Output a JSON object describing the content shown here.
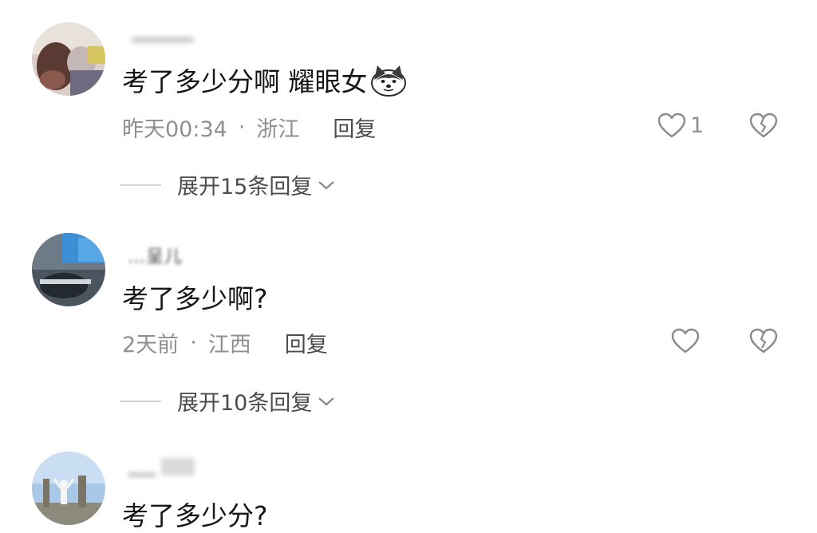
{
  "comments": [
    {
      "username": "",
      "text": "考了多少分啊 耀眼女",
      "emoji_icon": "husky-dog-icon",
      "time": "昨天00:34",
      "separator": "·",
      "location": "浙江",
      "reply_label": "回复",
      "likes": "1",
      "expand_label": "展开15条回复"
    },
    {
      "username": "…呈儿",
      "text": "考了多少啊?",
      "time": "2天前",
      "separator": "·",
      "location": "江西",
      "reply_label": "回复",
      "likes": "",
      "expand_label": "展开10条回复"
    },
    {
      "username": "",
      "text": "考了多少分?"
    }
  ],
  "colors": {
    "text_primary": "#161616",
    "text_secondary": "#8f8f8f",
    "reply_text": "#4c4c4c",
    "icon_stroke": "#8a8a8a",
    "divider": "#d4d4d4"
  }
}
